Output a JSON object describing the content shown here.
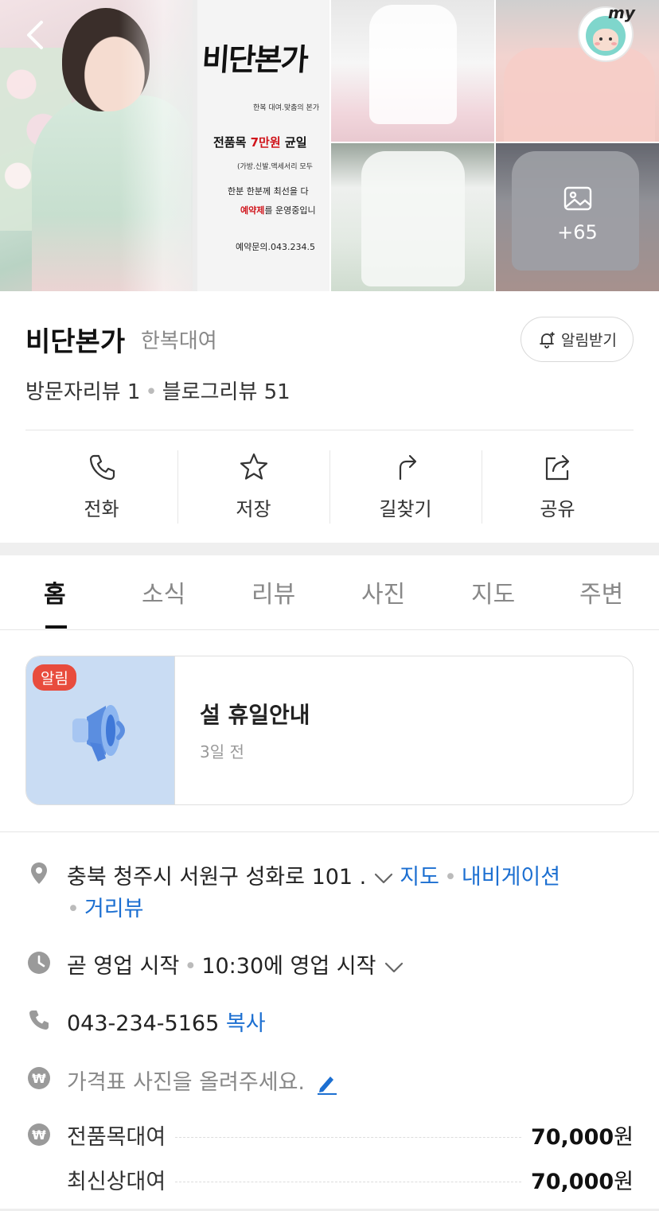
{
  "gallery": {
    "sign": {
      "logo": "비단본가",
      "sub": "한복 대여.맞춤의 본가",
      "line1_pre": "전품목 ",
      "line1_red": "7만원",
      "line1_post": " 균일",
      "line2": "(가방.신발.액세서리 모두",
      "line3": "한분 한분께 최선을 다",
      "line4_red": "예약제",
      "line4_post": "를 운영중입니",
      "line5": "예약문의.043.234.5"
    },
    "more_count": "+65",
    "profile_label": "my"
  },
  "place": {
    "name": "비단본가",
    "category": "한복대여",
    "alarm_label": "알림받기",
    "visitor_reviews": "방문자리뷰 1",
    "blog_reviews": "블로그리뷰 51"
  },
  "actions": [
    {
      "label": "전화",
      "icon": "phone-icon"
    },
    {
      "label": "저장",
      "icon": "star-icon"
    },
    {
      "label": "길찾기",
      "icon": "directions-icon"
    },
    {
      "label": "공유",
      "icon": "share-icon"
    }
  ],
  "tabs": [
    "홈",
    "소식",
    "리뷰",
    "사진",
    "지도",
    "주변"
  ],
  "active_tab": "홈",
  "notice": {
    "badge": "알림",
    "title": "설 휴일안내",
    "time": "3일 전"
  },
  "info": {
    "address": "충북 청주시 서원구 성화로 101 .",
    "map_link": "지도",
    "nav_link": "내비게이션",
    "street_view": "거리뷰",
    "hours_status": "곧 영업 시작",
    "hours_detail": "10:30에 영업 시작",
    "phone": "043-234-5165",
    "copy": "복사",
    "price_prompt": "가격표 사진을 올려주세요.",
    "prices": [
      {
        "name": "전품목대여",
        "amount": "70,000",
        "unit": "원"
      },
      {
        "name": "최신상대여",
        "amount": "70,000",
        "unit": "원"
      }
    ]
  },
  "colors": {
    "link": "#1c6fd1",
    "badge": "#e84c3d",
    "notice_bg": "#c9dcf3",
    "icon_gray": "#9a9a9a"
  }
}
